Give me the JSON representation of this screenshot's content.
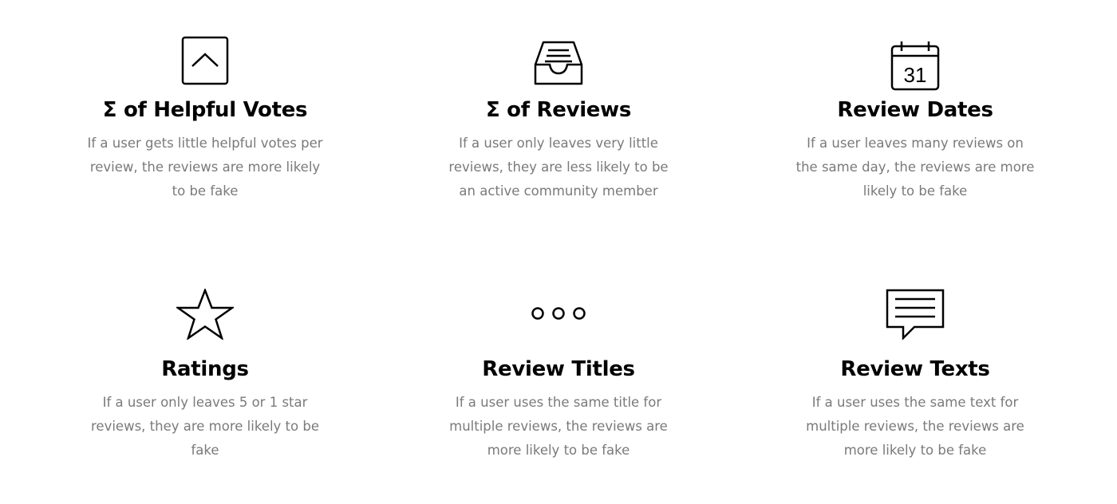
{
  "features": [
    {
      "icon": "chevron-up-box-icon",
      "title": "Σ of Helpful Votes",
      "description": "If a user gets little helpful votes per review, the reviews are more likely to be fake"
    },
    {
      "icon": "inbox-tray-icon",
      "title": "Σ of Reviews",
      "description": "If a user only leaves very little reviews, they are less likely to be an active community member"
    },
    {
      "icon": "calendar-icon",
      "calendar_day": "31",
      "title": "Review Dates",
      "description": "If a user leaves many reviews on the same day, the reviews are more likely to be fake"
    },
    {
      "icon": "star-icon",
      "title": "Ratings",
      "description": "If a user only leaves 5 or 1 star reviews, they are more likely to be fake"
    },
    {
      "icon": "ellipsis-icon",
      "title": "Review Titles",
      "description": "If a user uses the same title for multiple reviews, the reviews are more likely to be fake"
    },
    {
      "icon": "speech-bubble-icon",
      "title": "Review Texts",
      "description": "If a user uses the same text for multiple reviews, the reviews are more likely to be fake"
    }
  ]
}
